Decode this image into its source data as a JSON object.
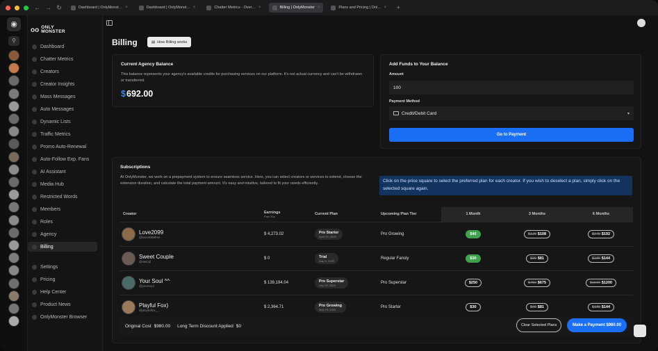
{
  "tabs": [
    {
      "label": "Dashboard | OnlyMonst…",
      "active": false
    },
    {
      "label": "Dashboard | OnlyMonst…",
      "active": false
    },
    {
      "label": "Chatter Metrics - Over…",
      "active": false
    },
    {
      "label": "Billing | OnlyMonster",
      "active": true
    },
    {
      "label": "Plans and Pricing | Onl…",
      "active": false
    }
  ],
  "brand": {
    "line1": "ONLY",
    "line2": "MONSTER",
    "eyes": "oo"
  },
  "sidebar": {
    "items": [
      {
        "label": "Dashboard"
      },
      {
        "label": "Chatter Metrics"
      },
      {
        "label": "Creators"
      },
      {
        "label": "Creator Insights"
      },
      {
        "label": "Mass Messages"
      },
      {
        "label": "Auto Messages"
      },
      {
        "label": "Dynamic Lists"
      },
      {
        "label": "Traffic Metrics"
      },
      {
        "label": "Promo Auto-Renewal"
      },
      {
        "label": "Auto-Follow Exp. Fans"
      },
      {
        "label": "AI Assistant"
      },
      {
        "label": "Media Hub"
      },
      {
        "label": "Restricted Words"
      },
      {
        "label": "Members"
      },
      {
        "label": "Roles"
      },
      {
        "label": "Agency"
      },
      {
        "label": "Billing",
        "active": true
      }
    ],
    "bottom": [
      {
        "label": "Settings"
      },
      {
        "label": "Pricing"
      },
      {
        "label": "Help Center"
      },
      {
        "label": "Product News"
      },
      {
        "label": "OnlyMonster Browser"
      }
    ]
  },
  "page": {
    "title": "Billing",
    "how_label": "How Billing works"
  },
  "balance": {
    "title": "Current Agency Balance",
    "desc": "This balance represents your agency's available credits for purchasing services on our platform. It's not actual currency and can't be withdrawn or transferred.",
    "currency": "$",
    "amount": "692.00"
  },
  "funds": {
    "title": "Add Funds to Your Balance",
    "amount_label": "Amount",
    "amount_value": "100",
    "method_label": "Payment Method",
    "method_value": "Credit/Debit Card",
    "pay_label": "Go to Payment"
  },
  "subs": {
    "title": "Subscriptions",
    "desc": "At OnlyMonster, we work on a prepayment system to ensure seamless service. Here, you can select creators or services to extend, choose the extension duration, and calculate the total payment amount. It's easy and intuitive, tailored to fit your needs efficiently.",
    "info": "Click on the price square to select the preferred plan for each creator. If you wish to deselect a plan, simply click on the selected square again."
  },
  "table": {
    "headers": {
      "creator": "Creator",
      "earnings": "Earnings",
      "earnings_sub": "Past 30d",
      "current": "Current Plan",
      "upcoming": "Upcoming Plan Tier",
      "m1": "1 Month",
      "m3": "3 Months",
      "m6": "6 Months"
    },
    "rows": [
      {
        "name": "Love2099",
        "handle": "@love2099free",
        "earnings": "$ 4,273.02",
        "plan": "Pro Starter",
        "plan_date": "April 29, 2025",
        "upcoming": "Pro Growing",
        "p1": "$40",
        "p1_sel": true,
        "p3_old": "$120",
        "p3": "$108",
        "p6_old": "$240",
        "p6": "$192",
        "avatar": "#8a6a4a"
      },
      {
        "name": "Sweet Couple",
        "handle": "@swtcpl",
        "earnings": "$ 0",
        "plan": "Trial",
        "plan_date": "May 9, 2025",
        "upcoming": "Regular Fansly",
        "p1": "$30",
        "p1_sel": true,
        "p3_old": "$90",
        "p3": "$81",
        "p6_old": "$180",
        "p6": "$144",
        "avatar": "#6b5a52"
      },
      {
        "name": "Your Soul ^^",
        "handle": "@yoursoul",
        "earnings": "$ 139,194.04",
        "plan": "Pro Superstar",
        "plan_date": "July 28, 2025",
        "upcoming": "Pro Superstar",
        "p1": "$250",
        "p1_sel": false,
        "p3_old": "$750",
        "p3": "$675",
        "p6_old": "$1500",
        "p6": "$1200",
        "avatar": "#4a6a6a"
      },
      {
        "name": "Playful Fox)",
        "handle": "@playfulfox__",
        "earnings": "$ 2,364.71",
        "plan": "Pro Growing",
        "plan_date": "May 29, 2025",
        "upcoming": "Pro Starter",
        "p1": "$30",
        "p1_sel": false,
        "p3_old": "$90",
        "p3": "$81",
        "p6_old": "$180",
        "p6": "$144",
        "avatar": "#9a7a5a"
      }
    ]
  },
  "footer": {
    "orig_label": "Original Cost",
    "orig": "$980.00",
    "disc_label": "Long Term Discount Applied",
    "disc": "$0",
    "clear": "Clear Selected Plans",
    "make": "Make a Payment $980.00"
  }
}
